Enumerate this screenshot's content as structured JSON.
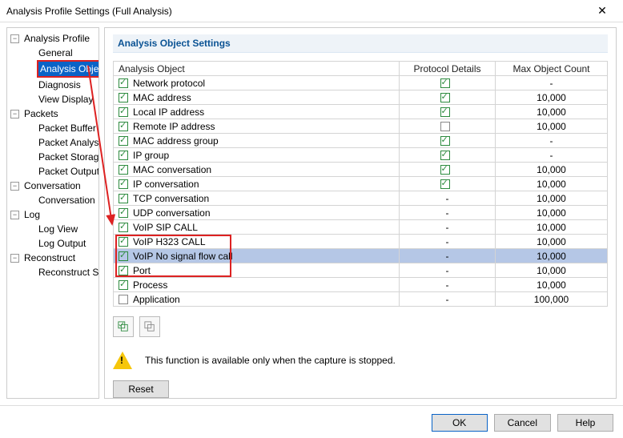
{
  "window": {
    "title": "Analysis Profile Settings (Full Analysis)"
  },
  "tree": {
    "n0": "Analysis Profile",
    "n0_0": "General",
    "n0_1": "Analysis Object",
    "n0_2": "Diagnosis",
    "n0_3": "View Display",
    "n1": "Packets",
    "n1_0": "Packet Buffer",
    "n1_1": "Packet Analysis",
    "n1_2": "Packet Storage",
    "n1_3": "Packet Output",
    "n2": "Conversation",
    "n2_0": "Conversation Filter",
    "n3": "Log",
    "n3_0": "Log View",
    "n3_1": "Log Output",
    "n4": "Reconstruct",
    "n4_0": "Reconstruct Settings"
  },
  "section": {
    "title": "Analysis Object Settings"
  },
  "cols": {
    "obj": "Analysis Object",
    "det": "Protocol Details",
    "cnt": "Max Object Count"
  },
  "rows": [
    {
      "name": "Network protocol",
      "chk": true,
      "det": "on",
      "cnt": "-"
    },
    {
      "name": "MAC address",
      "chk": true,
      "det": "on",
      "cnt": "10,000"
    },
    {
      "name": "Local IP address",
      "chk": true,
      "det": "on",
      "cnt": "10,000"
    },
    {
      "name": "Remote IP address",
      "chk": true,
      "det": "off",
      "cnt": "10,000"
    },
    {
      "name": "MAC address group",
      "chk": true,
      "det": "on",
      "cnt": "-"
    },
    {
      "name": "IP group",
      "chk": true,
      "det": "on",
      "cnt": "-"
    },
    {
      "name": "MAC conversation",
      "chk": true,
      "det": "on",
      "cnt": "10,000"
    },
    {
      "name": "IP conversation",
      "chk": true,
      "det": "on",
      "cnt": "10,000"
    },
    {
      "name": "TCP conversation",
      "chk": true,
      "det": "-",
      "cnt": "10,000"
    },
    {
      "name": "UDP conversation",
      "chk": true,
      "det": "-",
      "cnt": "10,000"
    },
    {
      "name": "VoIP SIP CALL",
      "chk": true,
      "det": "-",
      "cnt": "10,000"
    },
    {
      "name": "VoIP H323 CALL",
      "chk": true,
      "det": "-",
      "cnt": "10,000"
    },
    {
      "name": "VoIP No signal flow call",
      "chk": true,
      "det": "-",
      "cnt": "10,000",
      "hl": true
    },
    {
      "name": "Port",
      "chk": true,
      "det": "-",
      "cnt": "10,000"
    },
    {
      "name": "Process",
      "chk": true,
      "det": "-",
      "cnt": "10,000"
    },
    {
      "name": "Application",
      "chk": false,
      "det": "-",
      "cnt": "100,000"
    }
  ],
  "warn": "This function is available only when the capture is stopped.",
  "buttons": {
    "reset": "Reset",
    "ok": "OK",
    "cancel": "Cancel",
    "help": "Help"
  }
}
